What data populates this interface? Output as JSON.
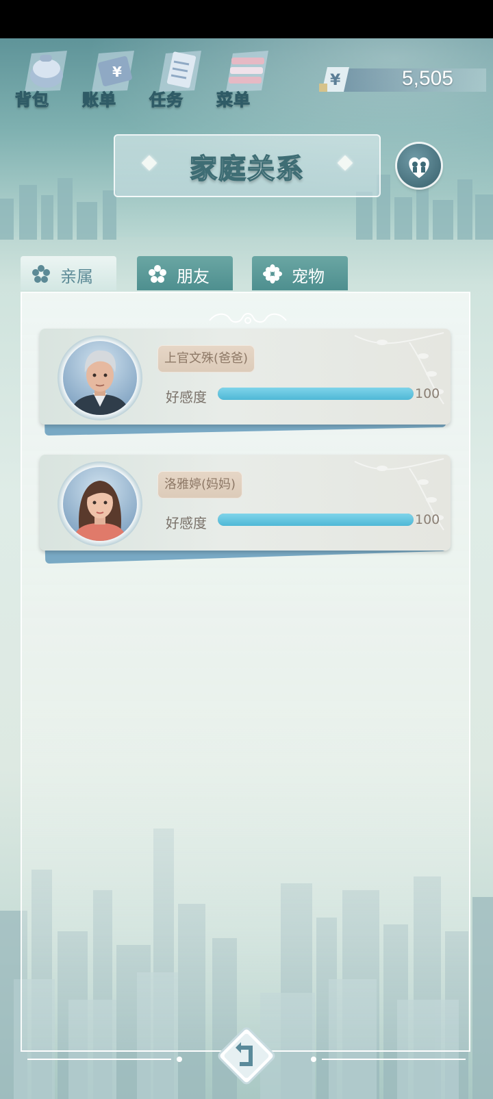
{
  "nav": {
    "items": [
      {
        "label": "背包",
        "icon": "backpack-icon"
      },
      {
        "label": "账单",
        "icon": "bill-icon"
      },
      {
        "label": "任务",
        "icon": "task-list-icon"
      },
      {
        "label": "菜单",
        "icon": "menu-icon"
      }
    ]
  },
  "currency": {
    "symbol": "¥",
    "amount": "5,505"
  },
  "page": {
    "title": "家庭关系"
  },
  "tabs": [
    {
      "label": "亲属",
      "active": true
    },
    {
      "label": "朋友",
      "active": false
    },
    {
      "label": "宠物",
      "active": false
    }
  ],
  "relations": [
    {
      "name": "上官文殊(爸爸)",
      "favor_label": "好感度",
      "favor_value": "100",
      "favor_ratio": 1.0
    },
    {
      "name": "洛雅婷(妈妈)",
      "favor_label": "好感度",
      "favor_value": "100",
      "favor_ratio": 1.0
    }
  ],
  "colors": {
    "accent": "#4fb8d6",
    "tab_active_text": "#5c8a96",
    "tag_bg": "#e6d6c6"
  }
}
